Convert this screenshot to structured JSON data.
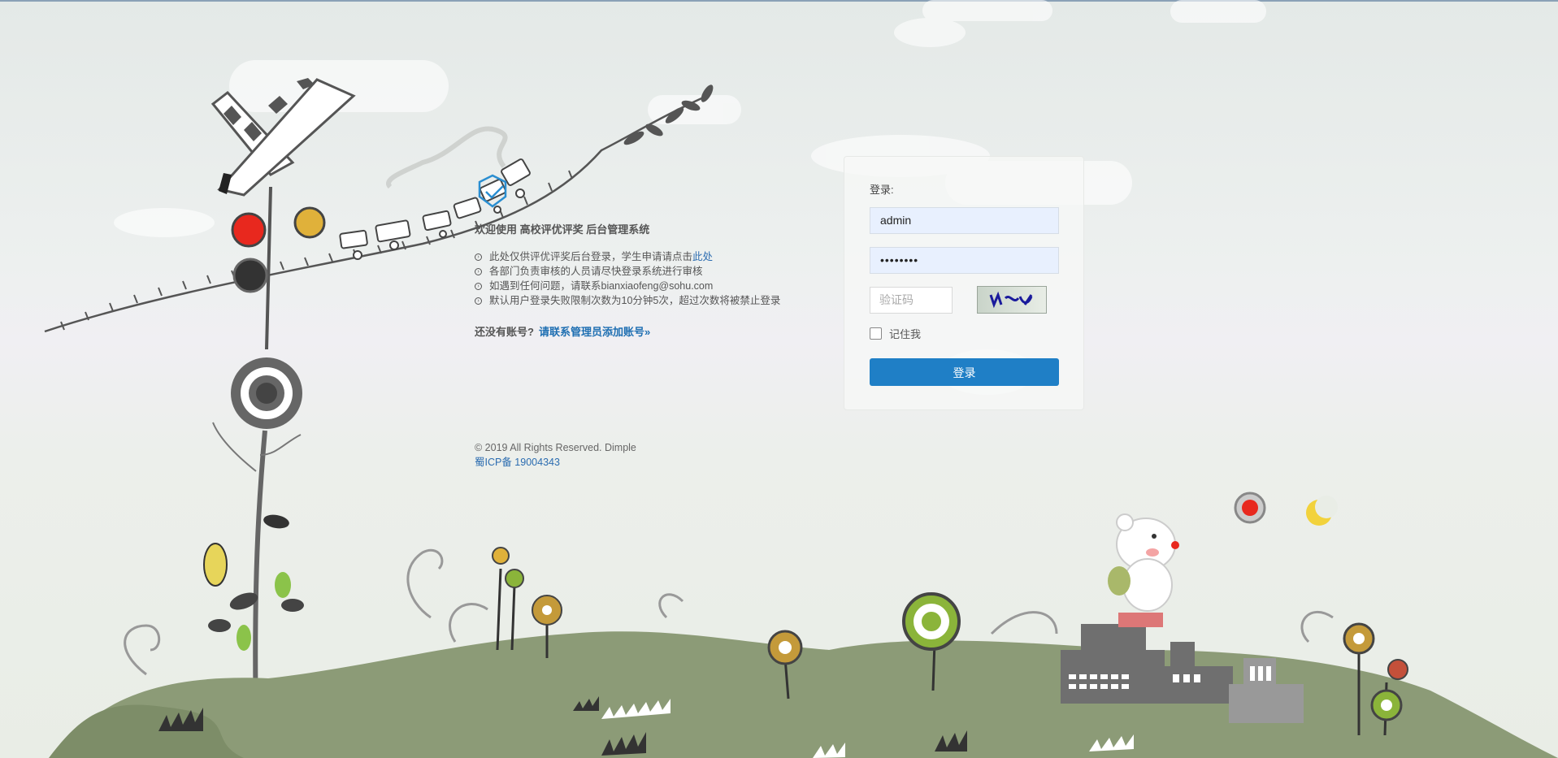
{
  "welcome": {
    "title": "欢迎使用 高校评优评奖 后台管理系统",
    "notes": [
      {
        "text": "此处仅供评优评奖后台登录，学生申请请点击",
        "link": "此处"
      },
      {
        "text": "各部门负责审核的人员请尽快登录系统进行审核",
        "link": ""
      },
      {
        "text": "如遇到任何问题，请联系bianxiaofeng@sohu.com",
        "link": ""
      },
      {
        "text": "默认用户登录失败限制次数为10分钟5次，超过次数将被禁止登录",
        "link": ""
      }
    ],
    "register_prompt": "还没有账号?",
    "register_link": "请联系管理员添加账号»"
  },
  "footer": {
    "copyright": "© 2019 All Rights Reserved. Dimple",
    "icp": "蜀ICP备 19004343"
  },
  "login": {
    "title": "登录:",
    "username_value": "admin",
    "password_mask": "••••••••",
    "captcha_placeholder": "验证码",
    "remember_label": "记住我",
    "submit_label": "登录"
  },
  "colors": {
    "accent": "#1f7fc6",
    "link": "#2b6cb0",
    "grass": "#8c9b77"
  },
  "icons": [
    "bullet-circle-icon",
    "shield-check-icon",
    "captcha-image",
    "checkbox-icon"
  ]
}
